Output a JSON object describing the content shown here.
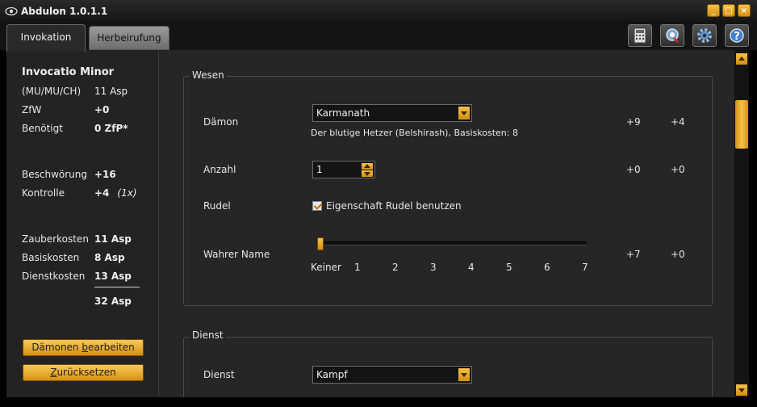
{
  "window": {
    "title": "Abdulon 1.0.1.1"
  },
  "tabs": [
    {
      "label": "Invokation"
    },
    {
      "label": "Herbeirufung"
    }
  ],
  "toolbar": {
    "icons": [
      "calculator-icon",
      "wizard-icon",
      "gear-icon",
      "help-icon"
    ]
  },
  "summary": {
    "spell_name": "Invocatio Minor",
    "attributes": "(MU/MU/CH)",
    "attributes_cost": "11 Asp",
    "zfw_label": "ZfW",
    "zfw_value": "+0",
    "benoetigt_label": "Benötigt",
    "benoetigt_value": "0 ZfP*",
    "beschwoerung_label": "Beschwörung",
    "beschwoerung_value": "+16",
    "kontrolle_label": "Kontrolle",
    "kontrolle_value": "+4",
    "kontrolle_note": "(1x)",
    "zauberkosten_label": "Zauberkosten",
    "zauberkosten_value": "11 Asp",
    "basiskosten_label": "Basiskosten",
    "basiskosten_value": "8 Asp",
    "dienstkosten_label": "Dienstkosten",
    "dienstkosten_value": "13 Asp",
    "total_value": "32 Asp"
  },
  "buttons": {
    "edit_pre": "Dämonen ",
    "edit_ul": "b",
    "edit_post": "earbeiten",
    "reset_ul": "Z",
    "reset_post": "urücksetzen"
  },
  "wesen": {
    "title": "Wesen",
    "daemon_label": "Dämon",
    "daemon_value": "Karmanath",
    "daemon_desc": "Der blutige Hetzer (Belshirash), Basiskosten: 8",
    "daemon_mod1": "+9",
    "daemon_mod2": "+4",
    "anzahl_label": "Anzahl",
    "anzahl_value": "1",
    "anzahl_mod1": "+0",
    "anzahl_mod2": "+0",
    "rudel_label": "Rudel",
    "rudel_checkbox_label": "Eigenschaft Rudel benutzen",
    "rudel_checked": true,
    "name_label": "Wahrer Name",
    "name_level": 0,
    "name_ticks": [
      "Keiner",
      "1",
      "2",
      "3",
      "4",
      "5",
      "6",
      "7"
    ],
    "name_mod1": "+7",
    "name_mod2": "+0"
  },
  "dienst": {
    "title": "Dienst",
    "dienst_label": "Dienst",
    "dienst_value": "Kampf"
  },
  "colors": {
    "accent": "#e8a222",
    "background": "#262626"
  }
}
